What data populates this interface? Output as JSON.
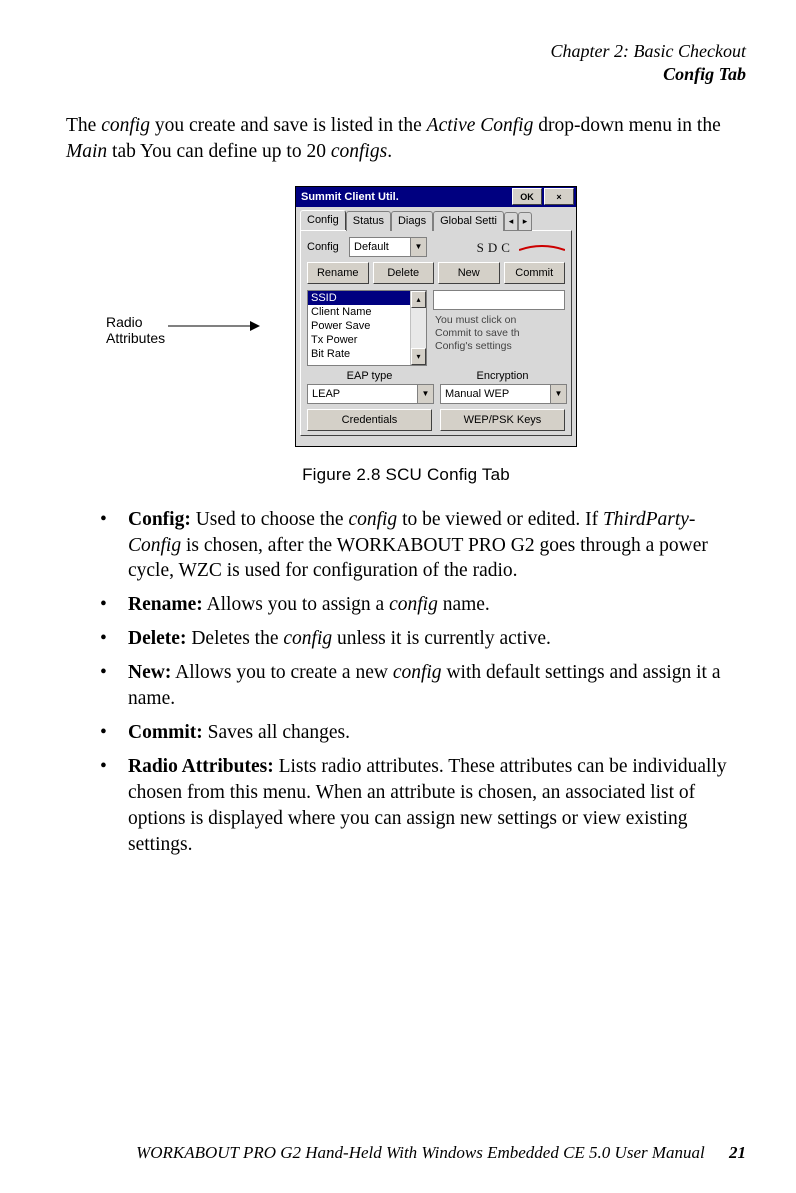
{
  "header": {
    "chapter": "Chapter 2: Basic Checkout",
    "section": "Config Tab"
  },
  "intro": {
    "p1a": "The ",
    "p1b": "config",
    "p1c": " you create and save is listed in the ",
    "p1d": "Active Config",
    "p1e": " drop-down menu in the ",
    "p1f": "Main",
    "p1g": " tab You can define up to 20 ",
    "p1h": "configs",
    "p1i": "."
  },
  "callout": {
    "line1": "Radio",
    "line2": "Attributes"
  },
  "scu": {
    "title": "Summit Client Util.",
    "ok": "OK",
    "close": "×",
    "tabs": {
      "config": "Config",
      "status": "Status",
      "diags": "Diags",
      "global": "Global Setti",
      "left": "◂",
      "right": "▸"
    },
    "configLabel": "Config",
    "configValue": "Default",
    "sdc": "SDC",
    "buttons": {
      "rename": "Rename",
      "delete": "Delete",
      "new_": "New",
      "commit": "Commit"
    },
    "listItems": [
      "SSID",
      "Client Name",
      "Power Save",
      "Tx Power",
      "Bit Rate"
    ],
    "scrollUp": "▴",
    "scrollDown": "▾",
    "info": "You must click on\nCommit to save th\nConfig's settings",
    "eapLabel": "EAP type",
    "eapValue": "LEAP",
    "encLabel": "Encryption",
    "encValue": "Manual WEP",
    "credBtn": "Credentials",
    "wepBtn": "WEP/PSK Keys"
  },
  "figcaption": "Figure 2.8 SCU Config Tab",
  "bullets": [
    {
      "b": "Config:",
      "t": " Used to choose the ",
      "i": "config",
      "t2": " to be viewed or edited. If ",
      "i2": "ThirdParty-Config",
      "t3": " is chosen, after the WORKABOUT PRO G2 goes through a power cycle, WZC is used for configuration of the radio."
    },
    {
      "b": "Rename:",
      "t": " Allows you to assign a ",
      "i": "config",
      "t2": " name.",
      "i2": "",
      "t3": ""
    },
    {
      "b": "Delete:",
      "t": " Deletes the ",
      "i": "config",
      "t2": " unless it is currently active.",
      "i2": "",
      "t3": ""
    },
    {
      "b": "New:",
      "t": " Allows you to create a new ",
      "i": "config",
      "t2": " with default settings and assign it a name.",
      "i2": "",
      "t3": ""
    },
    {
      "b": "Commit:",
      "t": " Saves all changes.",
      "i": "",
      "t2": "",
      "i2": "",
      "t3": ""
    },
    {
      "b": "Radio Attributes:",
      "t": " Lists radio attributes. These attributes can be individually chosen from this menu. When an attribute is chosen, an associated list of options is displayed where you can assign new settings or view existing settings.",
      "i": "",
      "t2": "",
      "i2": "",
      "t3": ""
    }
  ],
  "footer": {
    "text": "WORKABOUT PRO G2 Hand-Held With Windows Embedded CE 5.0 User Manual",
    "page": "21"
  }
}
